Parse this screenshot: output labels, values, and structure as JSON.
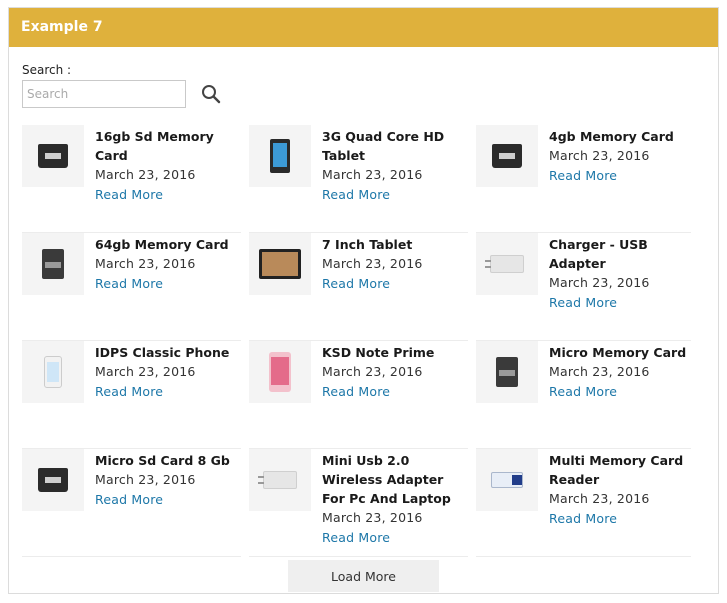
{
  "panel": {
    "title": "Example 7"
  },
  "search": {
    "label": "Search :",
    "placeholder": "Search",
    "value": ""
  },
  "products": [
    {
      "title": "16gb Sd Memory Card",
      "date": "March 23, 2016",
      "link": "Read More",
      "image": "sd-card-image"
    },
    {
      "title": "3G Quad Core HD Tablet",
      "date": "March 23, 2016",
      "link": "Read More",
      "image": "tablet-image"
    },
    {
      "title": "4gb Memory Card",
      "date": "March 23, 2016",
      "link": "Read More",
      "image": "sd-card-image"
    },
    {
      "title": "64gb Memory Card",
      "date": "March 23, 2016",
      "link": "Read More",
      "image": "micro-sd-image"
    },
    {
      "title": "7 Inch Tablet",
      "date": "March 23, 2016",
      "link": "Read More",
      "image": "tablet-landscape-image"
    },
    {
      "title": "Charger - USB Adapter",
      "date": "March 23, 2016",
      "link": "Read More",
      "image": "charger-image"
    },
    {
      "title": "IDPS Classic Phone",
      "date": "March 23, 2016",
      "link": "Read More",
      "image": "phone-white-image"
    },
    {
      "title": "KSD Note Prime",
      "date": "March 23, 2016",
      "link": "Read More",
      "image": "phone-pink-image"
    },
    {
      "title": "Micro Memory Card",
      "date": "March 23, 2016",
      "link": "Read More",
      "image": "micro-sd-image"
    },
    {
      "title": "Micro Sd Card 8 Gb",
      "date": "March 23, 2016",
      "link": "Read More",
      "image": "sd-card-image"
    },
    {
      "title": "Mini Usb 2.0 Wireless Adapter For Pc And Laptop",
      "date": "March 23, 2016",
      "link": "Read More",
      "image": "charger-image"
    },
    {
      "title": "Multi Memory Card Reader",
      "date": "March 23, 2016",
      "link": "Read More",
      "image": "card-reader-image"
    }
  ],
  "load_more": {
    "label": "Load More"
  },
  "colors": {
    "header": "#dfb13c",
    "link": "#1d77a8"
  }
}
